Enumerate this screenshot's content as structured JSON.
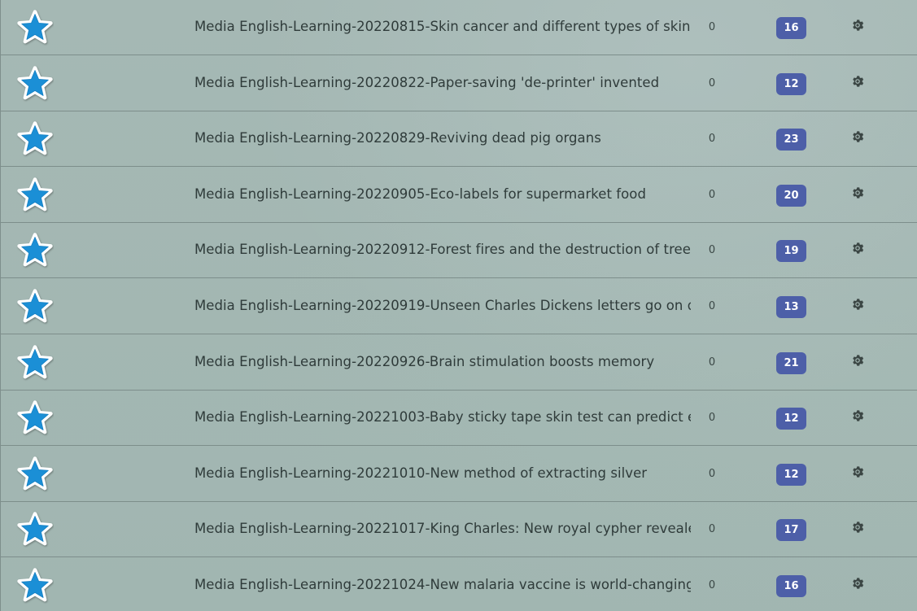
{
  "deck_list": {
    "star_icon": "star-icon",
    "options_icon": "gear-icon",
    "colors": {
      "star_fill": "#1b8fd6",
      "star_outline": "#ffffff",
      "badge_bg": "#4d5fa8",
      "row_border": "#7d8e8b"
    },
    "rows": [
      {
        "name": "Media English-Learning-20220815-Skin cancer and different types of skin",
        "new": "0",
        "due": "16"
      },
      {
        "name": "Media English-Learning-20220822-Paper-saving 'de-printer' invented",
        "new": "0",
        "due": "12"
      },
      {
        "name": "Media English-Learning-20220829-Reviving dead pig organs",
        "new": "0",
        "due": "23"
      },
      {
        "name": "Media English-Learning-20220905-Eco-labels for supermarket food",
        "new": "0",
        "due": "20"
      },
      {
        "name": "Media English-Learning-20220912-Forest fires and the destruction of trees",
        "new": "0",
        "due": "19"
      },
      {
        "name": "Media English-Learning-20220919-Unseen Charles Dickens letters go on disp",
        "new": "0",
        "due": "13"
      },
      {
        "name": "Media English-Learning-20220926-Brain stimulation boosts memory",
        "new": "0",
        "due": "21"
      },
      {
        "name": "Media English-Learning-20221003-Baby sticky tape skin test can predict ecze",
        "new": "0",
        "due": "12"
      },
      {
        "name": "Media English-Learning-20221010-New method of extracting silver",
        "new": "0",
        "due": "12"
      },
      {
        "name": "Media English-Learning-20221017-King Charles: New royal cypher revealed",
        "new": "0",
        "due": "17"
      },
      {
        "name": "Media English-Learning-20221024-New malaria vaccine is world-changing, sa",
        "new": "0",
        "due": "16"
      }
    ]
  }
}
